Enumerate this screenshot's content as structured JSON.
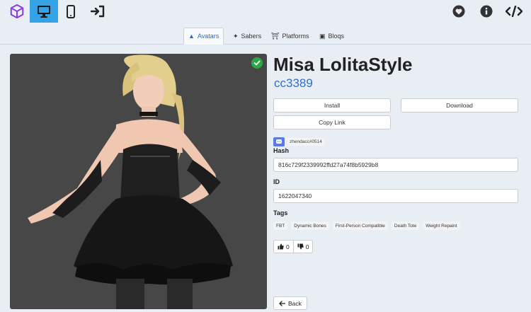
{
  "nav": {
    "left": [
      {
        "icon": "cube-logo-icon"
      },
      {
        "icon": "desktop-icon",
        "active": true
      },
      {
        "icon": "mobile-icon"
      },
      {
        "icon": "sign-in-icon"
      }
    ],
    "right": [
      {
        "icon": "heart-icon"
      },
      {
        "icon": "info-icon"
      },
      {
        "icon": "code-icon"
      }
    ]
  },
  "tabs": [
    {
      "label": "Avatars",
      "icon": "avatar-icon",
      "active": true
    },
    {
      "label": "Sabers",
      "icon": "wand-icon"
    },
    {
      "label": "Platforms",
      "icon": "torii-icon"
    },
    {
      "label": "Bloqs",
      "icon": "cube-icon"
    }
  ],
  "model": {
    "title": "Misa LolitaStyle",
    "author": "cc3389",
    "uploader": "zhendacc#0514",
    "hash_label": "Hash",
    "hash": "816c729f2339992ffd27a74f8b5929b8",
    "id_label": "ID",
    "id": "1622047340",
    "tags_label": "Tags",
    "tags": [
      "FBT",
      "Dynamic Bones",
      "First-Person Compatible",
      "Death Tote",
      "Weight Repaint"
    ],
    "likes": "0",
    "dislikes": "0"
  },
  "actions": {
    "install": "Install",
    "download": "Download",
    "copy_link": "Copy Link",
    "back": "Back"
  },
  "colors": {
    "accent": "#35a2e6",
    "author_link": "#2f6fc7",
    "verified": "#2aa845",
    "logo": "#8a3fd8"
  }
}
